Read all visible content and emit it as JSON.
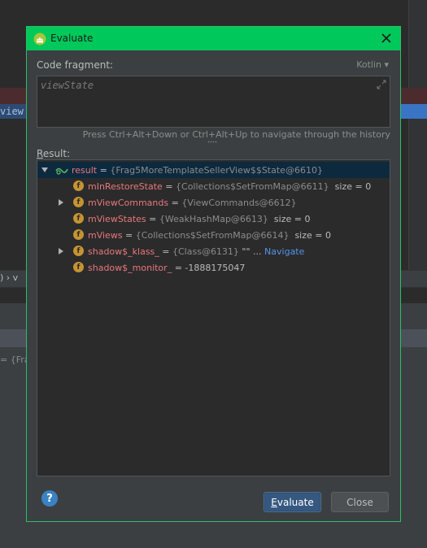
{
  "background": {
    "editor_fragment": "view",
    "navbar_text": ")  ›  v",
    "panel_fragment": "= {Fra"
  },
  "dialog": {
    "title": "Evaluate",
    "code_fragment_label": "Code fragment:",
    "language": "Kotlin ▾",
    "code_value": "viewState",
    "history_hint": "Press Ctrl+Alt+Down or Ctrl+Alt+Up to navigate through the history",
    "result_label": "Result:",
    "result_rows": [
      {
        "name": "result",
        "eq": " = ",
        "val": "{Frag5MoreTemplateSellerView$$State@6610}",
        "extra": ""
      },
      {
        "name": "mInRestoreState",
        "eq": " = ",
        "val": "{Collections$SetFromMap@6611}",
        "extra": "  size = 0"
      },
      {
        "name": "mViewCommands",
        "eq": " = ",
        "val": "{ViewCommands@6612}",
        "extra": ""
      },
      {
        "name": "mViewStates",
        "eq": " = ",
        "val": "{WeakHashMap@6613}",
        "extra": "  size = 0"
      },
      {
        "name": "mViews",
        "eq": " = ",
        "val": "{Collections$SetFromMap@6614}",
        "extra": "  size = 0"
      },
      {
        "name": "shadow$_klass_",
        "eq": " = ",
        "val": "{Class@6131}",
        "extra": " \"\" ... ",
        "link": "Navigate"
      },
      {
        "name": "shadow$_monitor_",
        "eq": " = ",
        "val": "",
        "extra": "-1888175047"
      }
    ],
    "field_icon_letter": "f",
    "evaluate_label": "Evaluate",
    "close_label": "Close",
    "help_label": "?"
  },
  "colors": {
    "title_bar": "#00c85a",
    "field_name": "#e8777d",
    "link": "#5394ec",
    "selected_row": "#0d293e"
  },
  "icons": [
    "android-icon",
    "close-icon",
    "expand-icon",
    "expand-arrow-icon",
    "collapse-arrow-icon",
    "watch-result-icon",
    "field-icon",
    "help-icon"
  ]
}
